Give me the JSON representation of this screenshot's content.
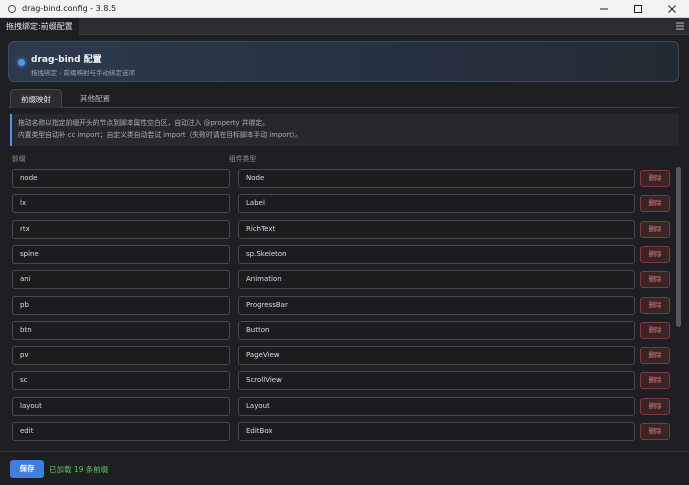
{
  "window": {
    "title": "drag-bind.config - 3.8.5"
  },
  "menubar": {
    "tab_label": "拖拽绑定:前缀配置"
  },
  "header": {
    "title": "drag-bind 配置",
    "subtitle": "拖拽绑定 - 前缀映射与手动绑定选项",
    "accent_color": "#4e95f2"
  },
  "tabs": [
    {
      "label": "前缀映射",
      "active": true
    },
    {
      "label": "其他配置",
      "active": false
    }
  ],
  "info": {
    "line1": "拖动名称以指定前缀开头的节点到脚本属性空白区，自动注入 @property 并绑定。",
    "line2": "内置类型自动补 cc import；自定义类自动尝试 import（失败时请在目标脚本手动 import）。"
  },
  "columns": {
    "prefix": "前缀",
    "component_type": "组件类型"
  },
  "delete_label": "删除",
  "mappings": [
    {
      "prefix": "node",
      "type": "Node"
    },
    {
      "prefix": "lx",
      "type": "Label"
    },
    {
      "prefix": "rtx",
      "type": "RichText"
    },
    {
      "prefix": "spine",
      "type": "sp.Skeleton"
    },
    {
      "prefix": "ani",
      "type": "Animation"
    },
    {
      "prefix": "pb",
      "type": "ProgressBar"
    },
    {
      "prefix": "btn",
      "type": "Button"
    },
    {
      "prefix": "pv",
      "type": "PageView"
    },
    {
      "prefix": "sc",
      "type": "ScrollView"
    },
    {
      "prefix": "layout",
      "type": "Layout"
    },
    {
      "prefix": "edit",
      "type": "EditBox"
    }
  ],
  "footer": {
    "save_label": "保存",
    "status": "已加载 19 条前缀",
    "status_color": "#58c26a"
  }
}
